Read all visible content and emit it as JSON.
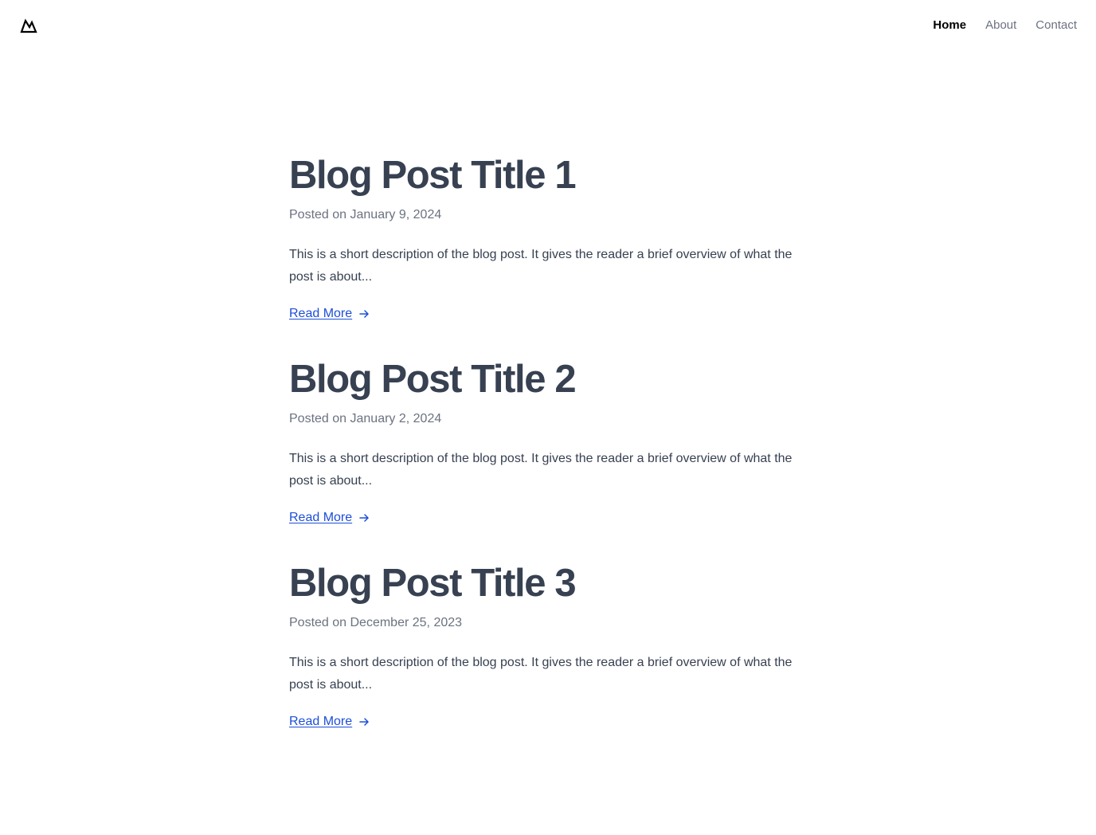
{
  "header": {
    "logo_icon": "mountain-logo-icon",
    "nav": [
      {
        "label": "Home",
        "active": true
      },
      {
        "label": "About",
        "active": false
      },
      {
        "label": "Contact",
        "active": false
      }
    ]
  },
  "posts": [
    {
      "title": "Blog Post Title 1",
      "date": "Posted on January 9, 2024",
      "description": "This is a short description of the blog post. It gives the reader a brief overview of what the post is about...",
      "read_more_label": "Read More",
      "read_more_icon": "arrow-right-icon"
    },
    {
      "title": "Blog Post Title 2",
      "date": "Posted on January 2, 2024",
      "description": "This is a short description of the blog post. It gives the reader a brief overview of what the post is about...",
      "read_more_label": "Read More",
      "read_more_icon": "arrow-right-icon"
    },
    {
      "title": "Blog Post Title 3",
      "date": "Posted on December 25, 2023",
      "description": "This is a short description of the blog post. It gives the reader a brief overview of what the post is about...",
      "read_more_label": "Read More",
      "read_more_icon": "arrow-right-icon"
    }
  ],
  "colors": {
    "title": "#374151",
    "muted": "#6b7280",
    "link": "#1d4ed8",
    "nav_active": "#000000"
  }
}
